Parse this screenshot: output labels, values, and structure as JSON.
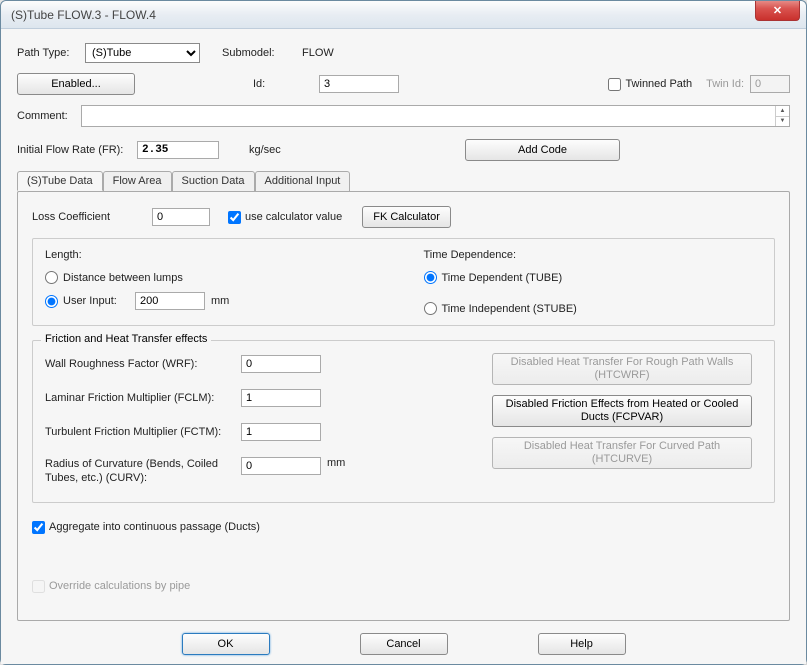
{
  "window": {
    "title": "(S)Tube FLOW.3 - FLOW.4",
    "close_glyph": "✕"
  },
  "header": {
    "pathtype_label": "Path Type:",
    "pathtype_value": "(S)Tube",
    "submodel_label": "Submodel:",
    "submodel_value": "FLOW",
    "enabled_button": "Enabled...",
    "id_label": "Id:",
    "id_value": "3",
    "twinned_label": "Twinned Path",
    "twinid_label": "Twin Id:",
    "twinid_value": "0",
    "comment_label": "Comment:",
    "ifr_label": "Initial Flow Rate (FR):",
    "ifr_value": "2.35",
    "ifr_unit": "kg/sec",
    "addcode_button": "Add Code"
  },
  "tabs": {
    "t0": "(S)Tube Data",
    "t1": "Flow Area",
    "t2": "Suction Data",
    "t3": "Additional Input"
  },
  "tubedata": {
    "losscoef_label": "Loss Coefficient",
    "losscoef_value": "0",
    "usecalc_label": "use calculator value",
    "fkcalc_button": "FK Calculator",
    "length_legend": "Length:",
    "len_opt1": "Distance between lumps",
    "len_opt2": "User Input:",
    "len_user_value": "200",
    "len_user_unit": "mm",
    "timedep_legend": "Time Dependence:",
    "td_opt1": "Time Dependent (TUBE)",
    "td_opt2": "Time Independent (STUBE)",
    "friction_legend": "Friction and Heat Transfer effects",
    "wrf_label": "Wall Roughness Factor (WRF):",
    "wrf_value": "0",
    "fclm_label": "Laminar Friction Multiplier (FCLM):",
    "fclm_value": "1",
    "fctm_label": "Turbulent Friction Multiplier (FCTM):",
    "fctm_value": "1",
    "curv_label": "Radius of Curvature (Bends, Coiled Tubes, etc.) (CURV):",
    "curv_value": "0",
    "curv_unit": "mm",
    "htcwrf_btn": "Disabled Heat Transfer For Rough Path Walls (HTCWRF)",
    "fcpvar_btn": "Disabled Friction Effects from Heated or Cooled Ducts (FCPVAR)",
    "htcurve_btn": "Disabled Heat Transfer For Curved Path (HTCURVE)",
    "aggregate_label": "Aggregate into continuous passage (Ducts)",
    "override_label": "Override calculations by pipe"
  },
  "footer": {
    "ok": "OK",
    "cancel": "Cancel",
    "help": "Help"
  }
}
